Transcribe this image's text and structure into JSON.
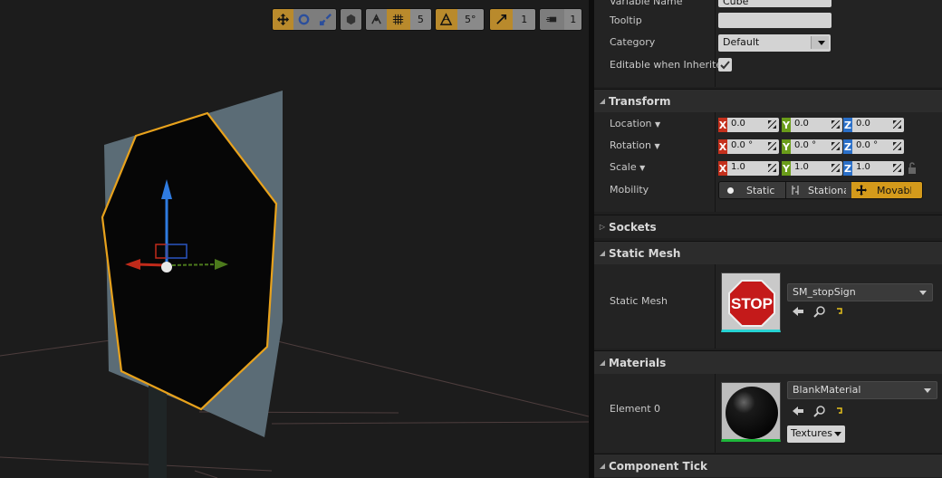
{
  "viewport_toolbar": {
    "grid_snap_value": "5",
    "rotation_snap_value": "5°",
    "scale_snap_value": "1",
    "camera_speed_value": "1",
    "icons": [
      "translate-icon",
      "rotate-icon",
      "scale-icon",
      "world-local-icon",
      "surface-snap-icon",
      "grid-snap-icon",
      "rotation-snap-icon",
      "scale-snap-icon",
      "camera-speed-icon"
    ]
  },
  "details": {
    "variable_name_label": "Variable Name",
    "variable_name_value": "Cube",
    "tooltip_label": "Tooltip",
    "tooltip_value": "",
    "category_label": "Category",
    "category_value": "Default",
    "editable_label": "Editable when Inherited",
    "editable_checked": true
  },
  "transform": {
    "title": "Transform",
    "location_label": "Location",
    "rotation_label": "Rotation",
    "scale_label": "Scale",
    "mobility_label": "Mobility",
    "location": {
      "x": "0.0",
      "y": "0.0",
      "z": "0.0"
    },
    "rotation": {
      "x": "0.0 °",
      "y": "0.0 °",
      "z": "0.0 °"
    },
    "scale": {
      "x": "1.0",
      "y": "1.0",
      "z": "1.0"
    },
    "axis_tags": {
      "x": "X",
      "y": "Y",
      "z": "Z"
    },
    "axis_colors": {
      "x": "#c4301c",
      "y": "#6a9c1a",
      "z": "#2a6fc8"
    },
    "mobility_options": [
      "Static",
      "Stationa",
      "Movabl"
    ],
    "mobility_selected": "Movabl"
  },
  "sockets": {
    "title": "Sockets"
  },
  "static_mesh": {
    "title": "Static Mesh",
    "label": "Static Mesh",
    "asset": "SM_stopSign",
    "thumb_text": "STOP"
  },
  "materials": {
    "title": "Materials",
    "element_label": "Element 0",
    "asset": "BlankMaterial",
    "textures_label": "Textures"
  },
  "component_tick": {
    "title": "Component Tick"
  },
  "colors": {
    "accent": "#d49a1b",
    "selection_outline": "#e8a21c"
  }
}
